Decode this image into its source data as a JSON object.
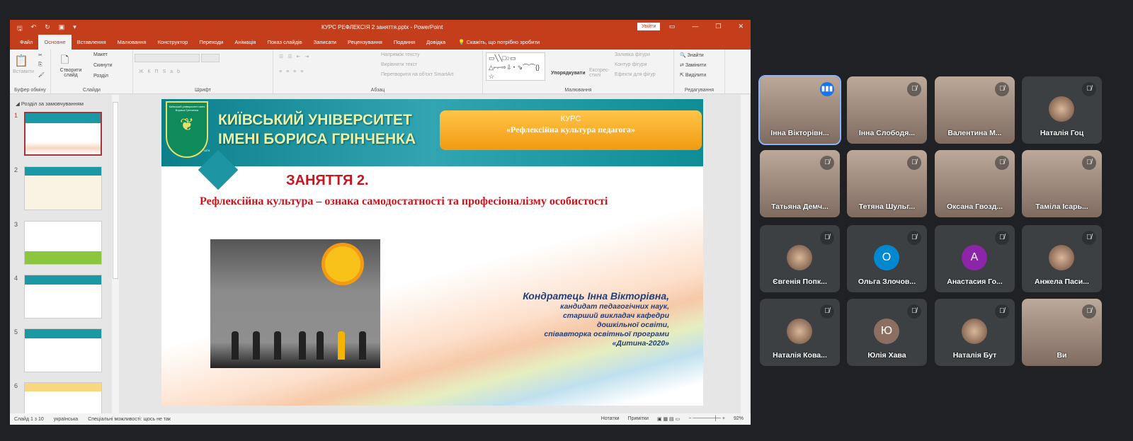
{
  "window": {
    "title": "КУРС РЕФЛЕКСІЯ 2 заняття.pptx  -  PowerPoint",
    "sign_in": "Увійти"
  },
  "tabs": [
    "Файл",
    "Основне",
    "Вставлення",
    "Малювання",
    "Конструктор",
    "Переходи",
    "Анімація",
    "Показ слайдів",
    "Записати",
    "Рецензування",
    "Подання",
    "Довідка"
  ],
  "active_tab": "Основне",
  "tell_me": "Скажіть, що потрібно зробити",
  "ribbon": {
    "clipboard": {
      "paste": "Вставити",
      "label": "Буфер обміну"
    },
    "slides": {
      "new_slide": "Створити слайд",
      "layout": "Макет",
      "reset": "Скинути",
      "section": "Розділ",
      "label": "Слайди"
    },
    "font": {
      "label": "Шрифт"
    },
    "paragraph": {
      "text_direction": "Напрямок тексту",
      "align_text": "Вирівняти текст",
      "smartart": "Перетворити на об'єкт SmartArt",
      "label": "Абзац"
    },
    "drawing": {
      "arrange": "Упорядкувати",
      "quick_styles": "Експрес-стилі",
      "shape_fill": "Заливка фігури",
      "shape_outline": "Контур фігури",
      "shape_effects": "Ефекти для фігур",
      "label": "Малювання"
    },
    "editing": {
      "find": "Знайти",
      "replace": "Замінити",
      "select": "Виділити",
      "label": "Редагування"
    }
  },
  "thumbnails": {
    "section": "Розділ за замовчуванням",
    "slides": [
      "1",
      "2",
      "3",
      "4",
      "5",
      "6"
    ]
  },
  "slide": {
    "university": [
      "КИЇВСЬКИЙ УНІВЕРСИТЕТ",
      "ІМЕНІ БОРИСА ГРІНЧЕНКА"
    ],
    "logo_text": "Київський університет імені Бориса Грінченка",
    "logo_year": "1874",
    "course_label": "КУРС",
    "course_name": "«Рефлексійна культура педагога»",
    "lesson": "ЗАНЯТТЯ 2.",
    "subtitle": "Рефлексійна культура – ознака самодостатності та професіоналізму особистості",
    "author_name": "Кондратець Інна Вікторівна,",
    "author_lines": [
      "кандидат педагогічних наук,",
      "старший викладач кафедри",
      "дошкільної освіти,",
      "співавторка освітньої програми",
      "«Дитина-2020»"
    ]
  },
  "status": {
    "slide": "Слайд 1 з 10",
    "language": "українська",
    "accessibility": "Спеціальні можливості: щось не так",
    "notes": "Нотатки",
    "comments": "Примітки",
    "zoom": "92%"
  },
  "participants": [
    {
      "name": "Інна Вікторівн...",
      "type": "video",
      "speaking": true
    },
    {
      "name": "Інна Слободя...",
      "type": "video"
    },
    {
      "name": "Валентина М...",
      "type": "video"
    },
    {
      "name": "Наталія Гоц",
      "type": "photo"
    },
    {
      "name": "Татьяна Демч...",
      "type": "video"
    },
    {
      "name": "Тетяна Шульг...",
      "type": "video"
    },
    {
      "name": "Оксана Гвозд...",
      "type": "video"
    },
    {
      "name": "Таміла Ісарь...",
      "type": "video"
    },
    {
      "name": "Євгенія Попк...",
      "type": "photo"
    },
    {
      "name": "Ольга Злочов...",
      "type": "initial",
      "initial": "О",
      "color": "#0288d1"
    },
    {
      "name": "Анастасия Го...",
      "type": "initial",
      "initial": "А",
      "color": "#8e24aa"
    },
    {
      "name": "Анжела Паси...",
      "type": "photo"
    },
    {
      "name": "Наталія Кова...",
      "type": "photo"
    },
    {
      "name": "Юлія Хава",
      "type": "initial",
      "initial": "Ю",
      "color": "#8d6e63"
    },
    {
      "name": "Наталія Бут",
      "type": "photo"
    },
    {
      "name": "Ви",
      "type": "video"
    }
  ],
  "colors": {
    "ppt_accent": "#c43e1c",
    "meet_bg": "#202124",
    "tile_bg": "#3c4043",
    "lesson_red": "#c8161d"
  }
}
